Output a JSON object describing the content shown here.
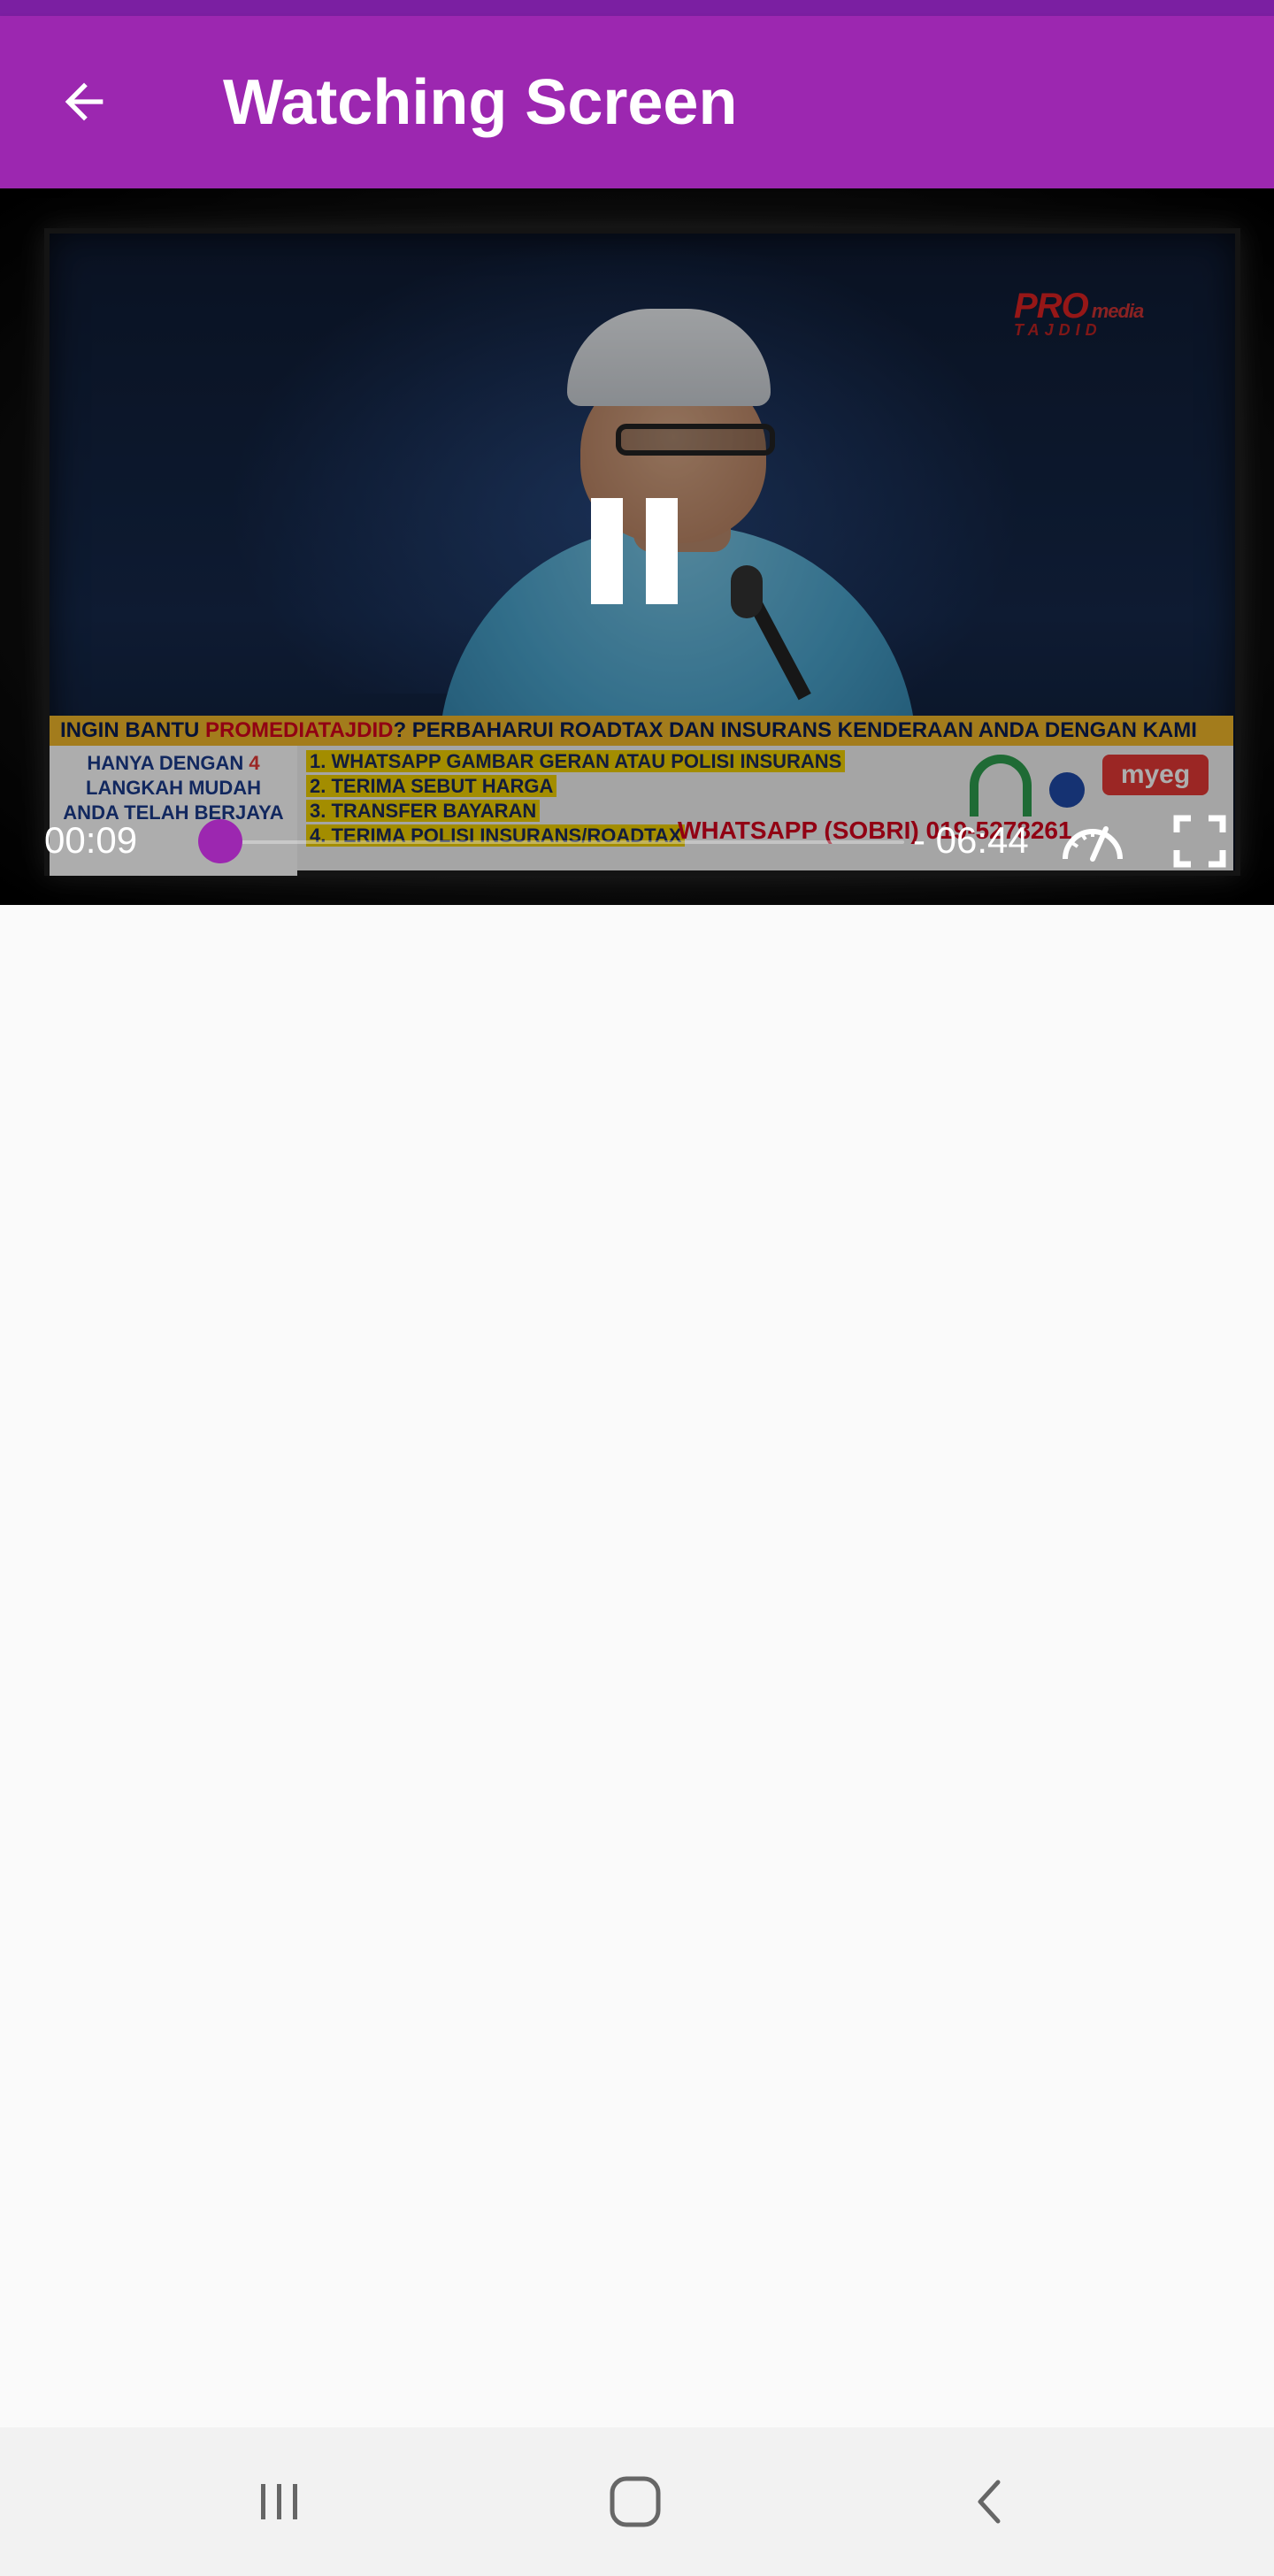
{
  "app_bar": {
    "title": "Watching Screen",
    "back_icon": "arrow-back-icon",
    "background": "#9c27b0",
    "status_bar_color": "#7b1fa2"
  },
  "video": {
    "overlay_text": {
      "banner_headline_prefix": "INGIN BANTU ",
      "banner_headline_brand": "PROMEDIATAJDID",
      "banner_headline_suffix": "? PERBAHARUI ROADTAX DAN INSURANS KENDERAAN ANDA DENGAN KAMI",
      "left_line1_prefix": "HANYA DENGAN ",
      "left_line1_num": "4",
      "left_line2": "LANGKAH MUDAH",
      "left_line3": "ANDA TELAH BERJAYA",
      "steps": [
        "1. WHATSAPP GAMBAR GERAN ATAU POLISI INSURANS",
        "2. TERIMA SEBUT HARGA",
        "3. TRANSFER BAYARAN",
        "4. TERIMA POLISI INSURANS/ROADTAX"
      ],
      "whatsapp": "WHATSAPP (SOBRI) 019-5278261",
      "partner_myeg": "myeg",
      "logo_main": "PRO",
      "logo_sub": "media",
      "logo_tag": "TAJDID"
    },
    "controls": {
      "pause_icon": "pause-icon",
      "elapsed": "00:09",
      "remaining": "- 06:44",
      "progress": 0.022,
      "accent": "#9c27b0",
      "speed_icon": "playback-speed-icon",
      "fullscreen_icon": "fullscreen-icon"
    }
  },
  "nav_bar": {
    "recents_icon": "recent-apps-icon",
    "home_icon": "home-icon",
    "back_icon": "nav-back-icon"
  }
}
